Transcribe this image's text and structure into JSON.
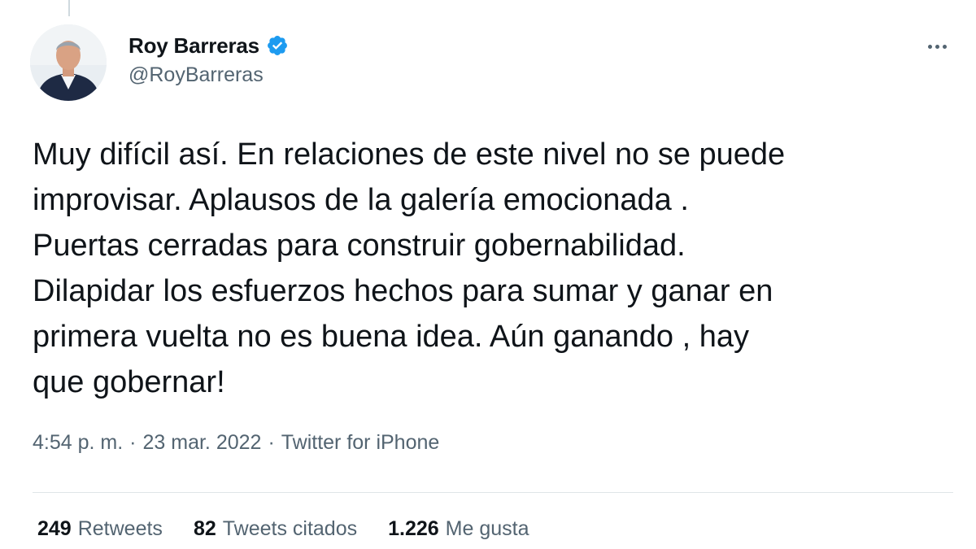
{
  "author": {
    "display_name": "Roy Barreras",
    "handle": "@RoyBarreras",
    "verified": true
  },
  "tweet": {
    "lines": [
      "Muy difícil así. En relaciones de este nivel no se puede",
      "improvisar. Aplausos de la galería emocionada .",
      "Puertas cerradas para construir gobernabilidad.",
      "Dilapidar los esfuerzos hechos para sumar y ganar en",
      "primera vuelta no es buena idea. Aún ganando , hay",
      "que gobernar!"
    ]
  },
  "meta": {
    "time": "4:54 p. m.",
    "separator": "·",
    "date": "23 mar. 2022",
    "source": "Twitter for iPhone"
  },
  "stats": {
    "retweets": {
      "count": "249",
      "label": "Retweets"
    },
    "quotes": {
      "count": "82",
      "label": "Tweets citados"
    },
    "likes": {
      "count": "1.226",
      "label": "Me gusta"
    }
  },
  "icons": {
    "verified": "verified-badge-icon",
    "more": "more-options-icon"
  },
  "colors": {
    "verified_blue": "#1d9bf0",
    "secondary_text": "#536471",
    "primary_text": "#0f1419"
  }
}
